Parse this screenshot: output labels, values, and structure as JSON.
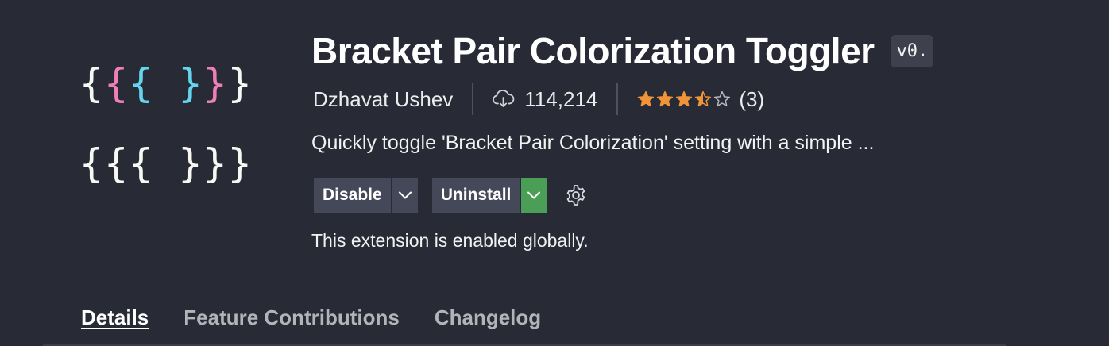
{
  "logo": {
    "row1": [
      {
        "ch": "{",
        "color": "#f8f8f2"
      },
      {
        "ch": "{",
        "color": "#ee7fb8"
      },
      {
        "ch": "{",
        "color": "#63d6ee"
      },
      {
        "ch": " ",
        "color": "#f8f8f2"
      },
      {
        "ch": "}",
        "color": "#63d6ee"
      },
      {
        "ch": "}",
        "color": "#ee7fb8"
      },
      {
        "ch": "}",
        "color": "#f8f8f2"
      }
    ],
    "row2": "{{{ }}}"
  },
  "extension": {
    "title": "Bracket Pair Colorization Toggler",
    "version": "v0.",
    "publisher": "Dzhavat Ushev",
    "installs": "114,214",
    "rating": 3.5,
    "rating_max": 5,
    "rating_count": "(3)",
    "description": "Quickly toggle 'Bracket Pair Colorization' setting with a simple ..."
  },
  "actions": {
    "disable_label": "Disable",
    "uninstall_label": "Uninstall"
  },
  "status_text": "This extension is enabled globally.",
  "tabs": [
    {
      "label": "Details",
      "active": true
    },
    {
      "label": "Feature Contributions",
      "active": false
    },
    {
      "label": "Changelog",
      "active": false
    }
  ],
  "colors": {
    "background": "#282a36",
    "star": "#f0943a",
    "uninstall_dropdown": "#4a9e55"
  },
  "icons": {
    "installs": "cloud-download-icon",
    "settings": "gear-icon"
  }
}
